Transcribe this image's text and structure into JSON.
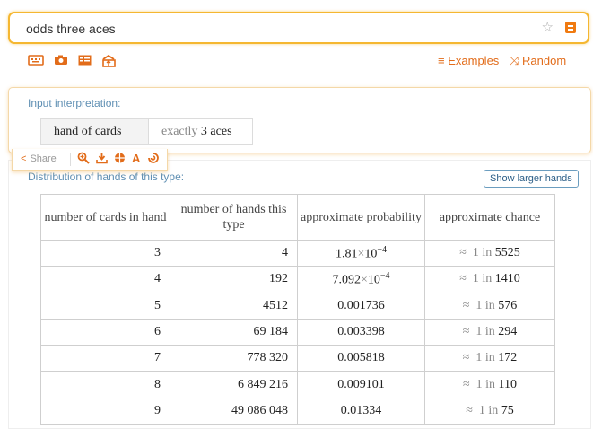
{
  "search": {
    "query": "odds three aces"
  },
  "toolbar": {
    "examples_label": "Examples",
    "random_label": "Random"
  },
  "pod1": {
    "title": "Input interpretation:",
    "chip_main": "hand of cards",
    "chip_qual_prefix": "exactly",
    "chip_qual_value": "3 aces"
  },
  "sharebar": {
    "share_label": "Share"
  },
  "pod2": {
    "title": "Distribution of hands of this type:",
    "larger_button": "Show larger hands",
    "columns": [
      "number of cards in hand",
      "number of hands this type",
      "approximate probability",
      "approximate chance"
    ],
    "rows": [
      {
        "cards": "3",
        "hands": "4",
        "prob_mant": "1.81",
        "prob_exp": "−4",
        "chance": "5525"
      },
      {
        "cards": "4",
        "hands": "192",
        "prob_mant": "7.092",
        "prob_exp": "−4",
        "chance": "1410"
      },
      {
        "cards": "5",
        "hands": "4512",
        "prob": "0.001736",
        "chance": "576"
      },
      {
        "cards": "6",
        "hands": "69 184",
        "prob": "0.003398",
        "chance": "294"
      },
      {
        "cards": "7",
        "hands": "778 320",
        "prob": "0.005818",
        "chance": "172"
      },
      {
        "cards": "8",
        "hands": "6 849 216",
        "prob": "0.009101",
        "chance": "110"
      },
      {
        "cards": "9",
        "hands": "49 086 048",
        "prob": "0.01334",
        "chance": "75"
      }
    ],
    "approx_symbol": "≈",
    "one_in": "1 in"
  }
}
